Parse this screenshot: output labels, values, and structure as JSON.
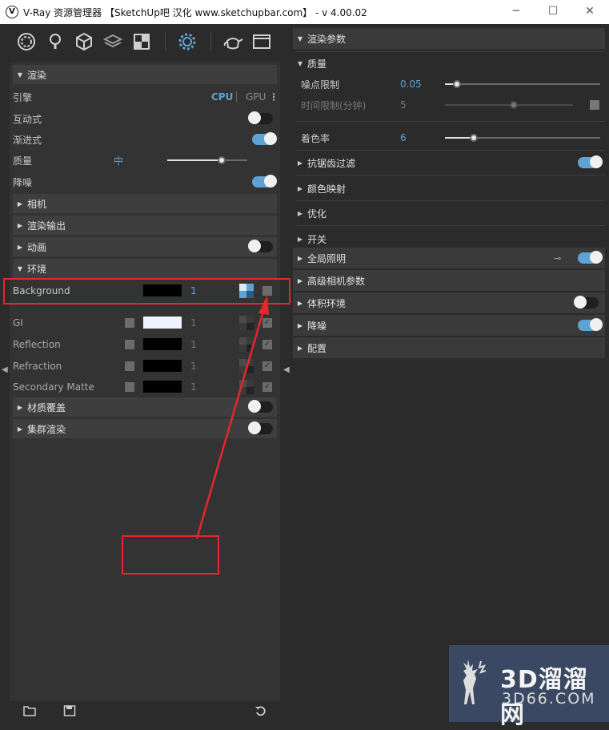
{
  "window": {
    "title": "V-Ray 资源管理器 【SketchUp吧 汉化 www.sketchupbar.com】 - v 4.00.02",
    "minimize": "─",
    "maximize": "☐",
    "close": "✕"
  },
  "left": {
    "render_section": "渲染",
    "engine_label": "引擎",
    "engine_cpu": "CPU",
    "engine_gpu": "GPU",
    "interactive_label": "互动式",
    "progressive_label": "渐进式",
    "quality_label": "质量",
    "quality_value": "中",
    "denoise_label": "降噪",
    "camera_section": "相机",
    "output_section": "渲染输出",
    "animation_section": "动画",
    "environment_section": "环境",
    "env_rows": [
      {
        "label": "Background",
        "value": "1",
        "color": "#000000"
      },
      {
        "label": "GI",
        "value": "1",
        "color": "#eef4ff"
      },
      {
        "label": "Reflection",
        "value": "1",
        "color": "#000000"
      },
      {
        "label": "Refraction",
        "value": "1",
        "color": "#000000"
      },
      {
        "label": "Secondary Matte",
        "value": "1",
        "color": "#000000"
      }
    ],
    "material_override_section": "材质覆盖",
    "swarm_section": "集群渲染"
  },
  "right": {
    "render_params": "渲染参数",
    "quality": "质量",
    "noise_limit_label": "噪点限制",
    "noise_limit_value": "0.05",
    "time_limit_label": "时间限制(分钟)",
    "time_limit_value": "5",
    "shading_rate_label": "着色率",
    "shading_rate_value": "6",
    "antialias": "抗锯齿过滤",
    "color_mapping": "颜色映射",
    "optimize": "优化",
    "switches": "开关",
    "gi": "全局照明",
    "advanced_camera": "高级相机参数",
    "volumetric": "体积环境",
    "denoise": "降噪",
    "config": "配置"
  },
  "watermark": {
    "big": "3D溜溜网",
    "small": "3D66.COM"
  },
  "colors": {
    "accent": "#5fa3d4",
    "annotation": "#e8262c",
    "bg": "#2b2b2b"
  }
}
